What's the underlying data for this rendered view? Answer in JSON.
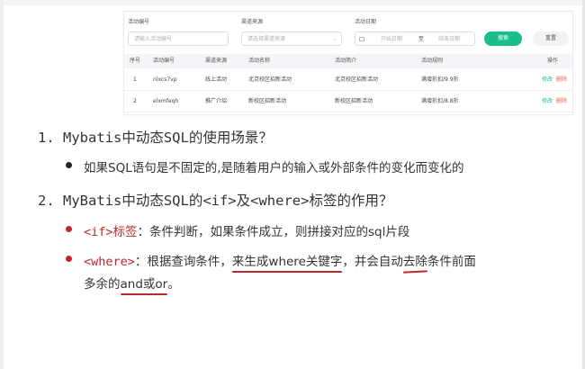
{
  "embedded_screenshot": {
    "filters": {
      "activity_id_label": "活动编号",
      "activity_id_placeholder": "请输入活动编号",
      "channel_label": "渠道来源",
      "channel_placeholder": "请选择渠道来源",
      "date_label": "活动日期",
      "date_start": "开始日期",
      "date_sep": "至",
      "date_end": "结束日期",
      "search_button": "搜索",
      "reset_button": "重置"
    },
    "table": {
      "headers": [
        "序号",
        "活动编号",
        "渠道来源",
        "活动名称",
        "活动简介",
        "活动规则",
        "操作"
      ],
      "rows": [
        {
          "no": "1",
          "code": "nlxcs7vp",
          "channel": "线上活动",
          "name": "北京校区招新活动",
          "intro": "北京校区招新活动",
          "rule": "满增折扣/9.9折",
          "edit": "修改",
          "delete": "删除"
        },
        {
          "no": "2",
          "code": "elxmfeqh",
          "channel": "推广介绍",
          "name": "新校区招新活动",
          "intro": "新校区招新活动",
          "rule": "满增折扣/8.8折",
          "edit": "修改",
          "delete": "删除"
        }
      ]
    },
    "colors": {
      "accent": "#19be8c",
      "danger": "#e85a5a"
    }
  },
  "slide": {
    "heading1": "1. Mybatis中动态SQL的使用场景？",
    "bullet1": "如果SQL语句是不固定的,是随着用户的输入或外部条件的变化而变化的",
    "heading2": "2. MyBatis中动态SQL的<if>及<where>标签的作用？",
    "bullet2": {
      "tag": "<if>标签",
      "text": "：条件判断，如果条件成立，则拼接对应的sql片段"
    },
    "bullet3": {
      "tag": "<where>",
      "text1": "：根据查询条件，",
      "hl1": "来生成where关键字",
      "text2": "，并会自动",
      "hl2": "去除",
      "text3": "条件前面",
      "line2_text": "多余的",
      "hl3": "and或or",
      "line2_end": "。"
    },
    "colors": {
      "tag_red": "#c0262b",
      "text": "#333333"
    }
  }
}
